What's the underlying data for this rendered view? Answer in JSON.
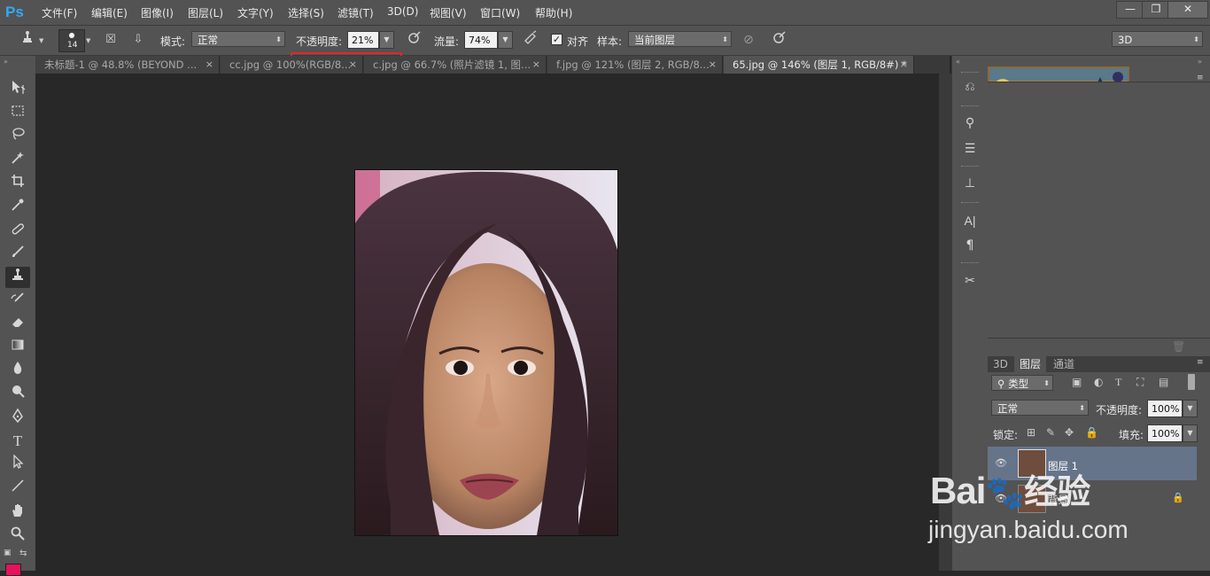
{
  "app": {
    "logo": "Ps"
  },
  "menu": [
    "文件(F)",
    "编辑(E)",
    "图像(I)",
    "图层(L)",
    "文字(Y)",
    "选择(S)",
    "滤镜(T)",
    "3D(D)",
    "视图(V)",
    "窗口(W)",
    "帮助(H)"
  ],
  "window_buttons": {
    "minimize": "—",
    "restore": "❐",
    "close": "✕"
  },
  "options": {
    "brush_size": "14",
    "mode_label": "模式:",
    "mode_value": "正常",
    "opacity_label": "不透明度:",
    "opacity_value": "21%",
    "flow_label": "流量:",
    "flow_value": "74%",
    "align_label": "对齐",
    "align_checked": true,
    "sample_label": "样本:",
    "sample_value": "当前图层",
    "workspace_value": "3D"
  },
  "tabs": [
    {
      "label": "未标题-1 @ 48.8% (BEYOND ...",
      "active": false
    },
    {
      "label": "cc.jpg @ 100%(RGB/8...",
      "active": false
    },
    {
      "label": "c.jpg @ 66.7% (照片滤镜 1, 图...",
      "active": false
    },
    {
      "label": "f.jpg @ 121% (图层 2, RGB/8...",
      "active": false
    },
    {
      "label": "65.jpg @ 146% (图层 1, RGB/8#) *",
      "active": true
    }
  ],
  "tab_close": "×",
  "tools": [
    "move-tool",
    "marquee-tool",
    "lasso-tool",
    "magic-wand-tool",
    "crop-tool",
    "eyedropper-tool",
    "healing-brush-tool",
    "brush-tool",
    "clone-stamp-tool",
    "history-brush-tool",
    "eraser-tool",
    "gradient-tool",
    "blur-tool",
    "dodge-tool",
    "pen-tool",
    "type-tool",
    "path-selection-tool",
    "line-tool",
    "hand-tool",
    "zoom-tool"
  ],
  "tool_glyphs": {
    "type-tool": "T"
  },
  "layers_panel": {
    "tabs": [
      "3D",
      "图层",
      "通道"
    ],
    "active_tab": "图层",
    "filter_label": "类型",
    "blend_mode": "正常",
    "opacity_label": "不透明度:",
    "opacity_value": "100%",
    "lock_label": "锁定:",
    "fill_label": "填充:",
    "fill_value": "100%",
    "layers": [
      {
        "name": "图层 1",
        "selected": true
      },
      {
        "name": "背景",
        "selected": false,
        "locked": true
      }
    ]
  },
  "watermark": {
    "brand": "Bai",
    "brand2": "经验",
    "url": "jingyan.baidu.com"
  },
  "colors": {
    "accent_red": "#e3262b",
    "ps_blue": "#31a8ff"
  }
}
